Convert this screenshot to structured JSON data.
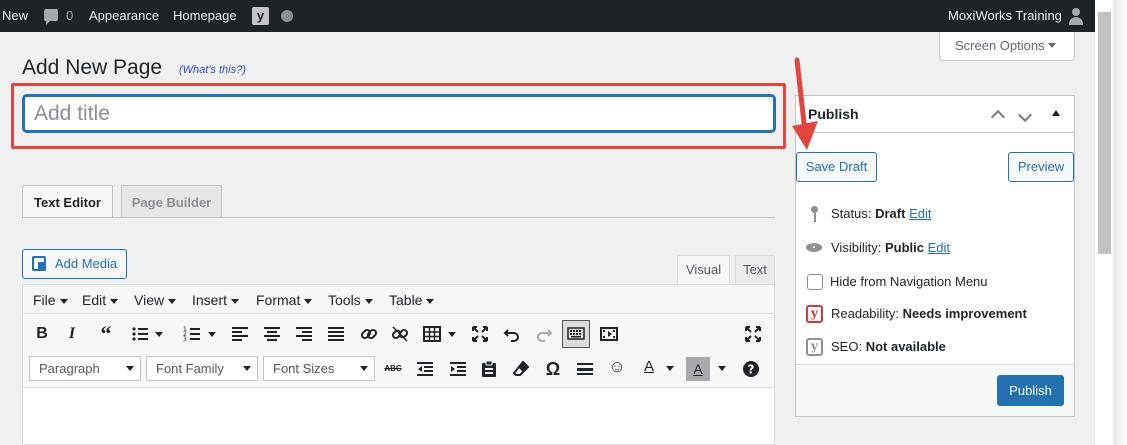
{
  "admin_bar": {
    "new": "New",
    "comment_count": "0",
    "appearance": "Appearance",
    "homepage": "Homepage",
    "account": "MoxiWorks Training"
  },
  "screen_options": "Screen Options",
  "page": {
    "title": "Add New Page",
    "whats_this": "(What's this?)",
    "title_placeholder": "Add title",
    "title_value": ""
  },
  "editor_tabs": [
    "Text Editor",
    "Page Builder"
  ],
  "add_media": "Add Media",
  "mode_tabs": {
    "visual": "Visual",
    "text": "Text"
  },
  "menubar": [
    "File",
    "Edit",
    "View",
    "Insert",
    "Format",
    "Tools",
    "Table"
  ],
  "format_selects": {
    "paragraph": "Paragraph",
    "font_family": "Font Family",
    "font_sizes": "Font Sizes"
  },
  "toolbar_icons_row1": [
    "bold-icon",
    "italic-icon",
    "blockquote-icon",
    "bullet-list-icon",
    "numbered-list-icon",
    "align-left-icon",
    "align-center-icon",
    "align-right-icon",
    "justify-icon",
    "link-icon",
    "unlink-icon",
    "table-icon",
    "fullscreen-icon",
    "undo-icon",
    "redo-icon",
    "keyboard-icon",
    "video-icon",
    "expand-icon"
  ],
  "toolbar_icons_row2": [
    "strikethrough-icon",
    "outdent-icon",
    "indent-icon",
    "paste-icon",
    "eraser-icon",
    "omega-icon",
    "horizontal-rule-icon",
    "emoticon-icon",
    "text-color-icon",
    "background-color-icon",
    "help-icon"
  ],
  "publish": {
    "title": "Publish",
    "save_draft": "Save Draft",
    "preview": "Preview",
    "status_label": "Status:",
    "status_value": "Draft",
    "visibility_label": "Visibility:",
    "visibility_value": "Public",
    "edit": "Edit",
    "hide_nav": "Hide from Navigation Menu",
    "readability_label": "Readability:",
    "readability_value": "Needs improvement",
    "seo_label": "SEO:",
    "seo_value": "Not available",
    "publish_button": "Publish"
  },
  "colors": {
    "accent": "#2271b1",
    "admin_bar": "#1d2327",
    "highlight": "#e0463e",
    "yoast_red": "#dc3232"
  }
}
